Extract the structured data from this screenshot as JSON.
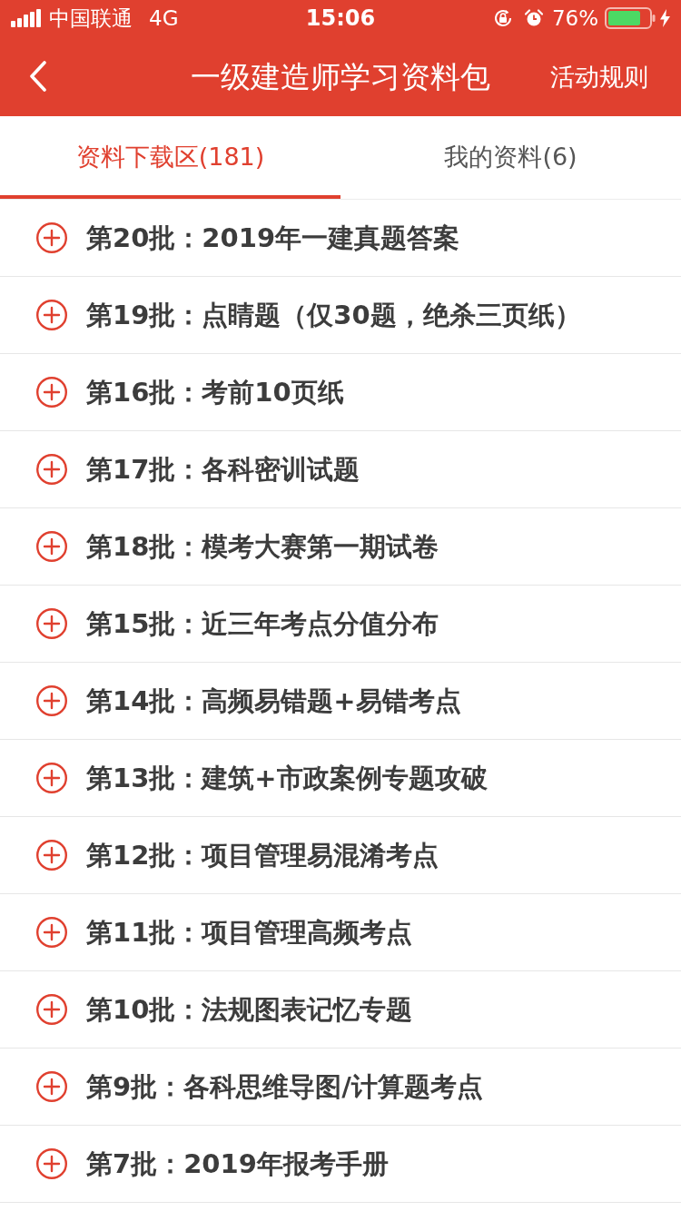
{
  "status_bar": {
    "carrier": "中国联通",
    "network": "4G",
    "time": "15:06",
    "battery": "76%"
  },
  "header": {
    "title": "一级建造师学习资料包",
    "action": "活动规则"
  },
  "tabs": [
    {
      "label": "资料下载区(181)",
      "selected": true
    },
    {
      "label": "我的资料(6)",
      "selected": false
    }
  ],
  "items": [
    {
      "title": "第20批：2019年一建真题答案"
    },
    {
      "title": "第19批：点睛题（仅30题，绝杀三页纸）"
    },
    {
      "title": "第16批：考前10页纸"
    },
    {
      "title": "第17批：各科密训试题"
    },
    {
      "title": "第18批：模考大赛第一期试卷"
    },
    {
      "title": "第15批：近三年考点分值分布"
    },
    {
      "title": "第14批：高频易错题+易错考点"
    },
    {
      "title": "第13批：建筑+市政案例专题攻破"
    },
    {
      "title": "第12批：项目管理易混淆考点"
    },
    {
      "title": "第11批：项目管理高频考点"
    },
    {
      "title": "第10批：法规图表记忆专题"
    },
    {
      "title": "第9批：各科思维导图/计算题考点"
    },
    {
      "title": "第7批：2019年报考手册"
    }
  ]
}
